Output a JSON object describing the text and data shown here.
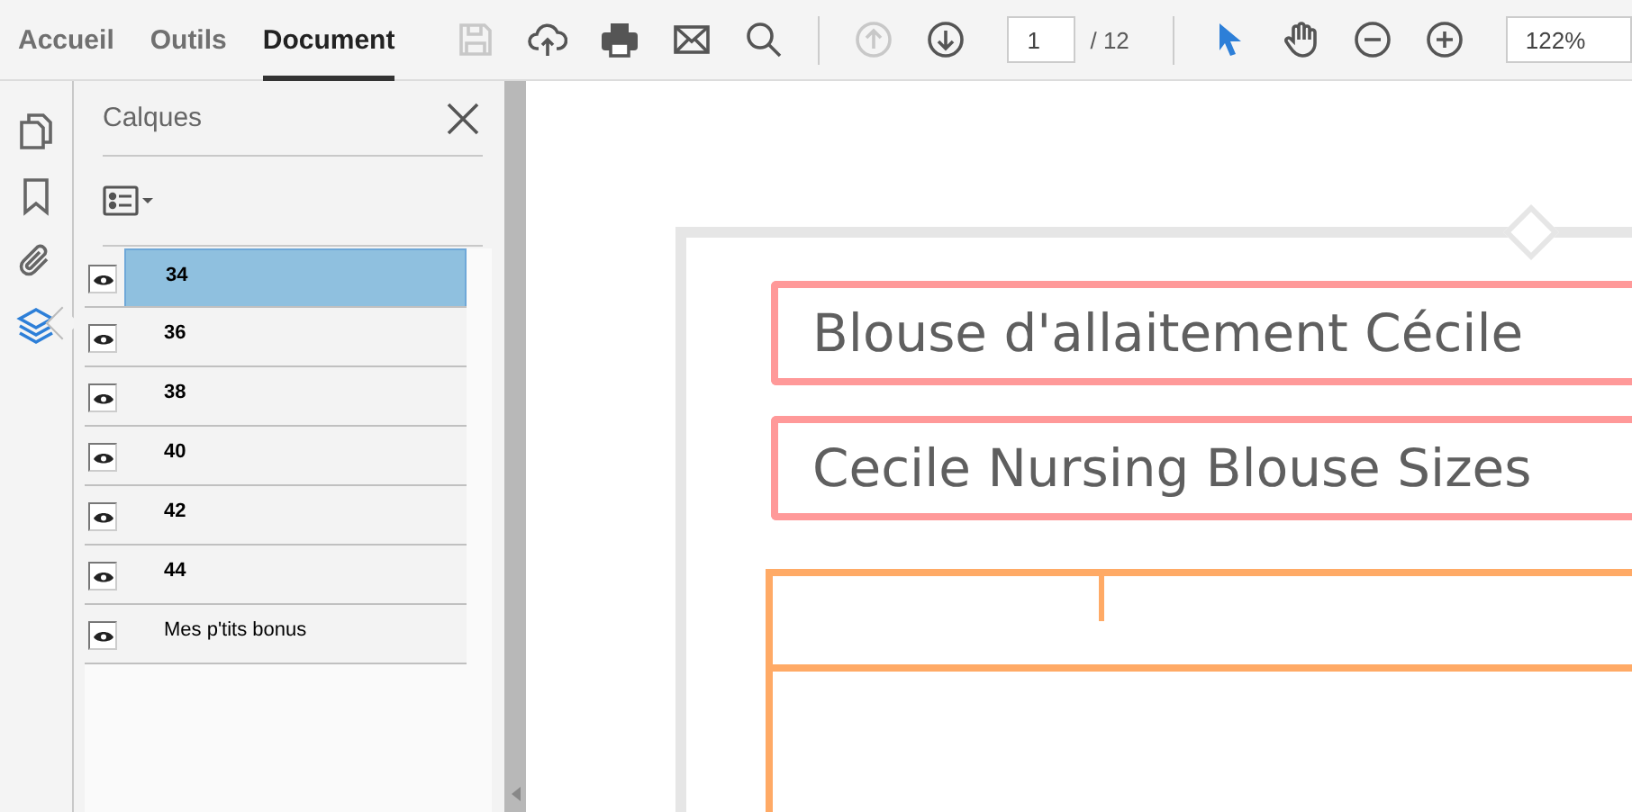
{
  "tabs": [
    {
      "label": "Accueil",
      "selected": false
    },
    {
      "label": "Outils",
      "selected": false
    },
    {
      "label": "Document",
      "selected": true
    }
  ],
  "toolbar": {
    "tools": [
      {
        "kind": "save",
        "disabled": true
      },
      {
        "kind": "upload",
        "disabled": false
      },
      {
        "kind": "print",
        "disabled": false
      },
      {
        "kind": "mail",
        "disabled": false
      },
      {
        "kind": "search",
        "disabled": false
      },
      {
        "kind": "separator"
      },
      {
        "kind": "prev",
        "disabled": true
      },
      {
        "kind": "next",
        "disabled": false
      },
      {
        "kind": "page"
      },
      {
        "kind": "separator"
      },
      {
        "kind": "pointer",
        "selected": true
      },
      {
        "kind": "hand",
        "selected": false
      },
      {
        "kind": "zoomout",
        "disabled": false
      },
      {
        "kind": "zoomin",
        "disabled": false
      },
      {
        "kind": "zoom"
      }
    ],
    "page_number": "1",
    "page_total": "/ 12",
    "zoom": "122%"
  },
  "rail": [
    {
      "kind": "pages",
      "selected": false
    },
    {
      "kind": "bookmark",
      "selected": false
    },
    {
      "kind": "attachment",
      "selected": false
    },
    {
      "kind": "layers",
      "selected": true
    }
  ],
  "layers_panel": {
    "title": "Calques",
    "layers": [
      {
        "label": "34",
        "visible": true,
        "selected": true
      },
      {
        "label": "36",
        "visible": true,
        "selected": false
      },
      {
        "label": "38",
        "visible": true,
        "selected": false
      },
      {
        "label": "40",
        "visible": true,
        "selected": false
      },
      {
        "label": "42",
        "visible": true,
        "selected": false
      },
      {
        "label": "44",
        "visible": true,
        "selected": false
      },
      {
        "label": "Mes p'tits bonus",
        "visible": true,
        "selected": false
      }
    ]
  },
  "document": {
    "headings": [
      "Blouse d'allaitement Cécile",
      "Cecile Nursing Blouse Sizes"
    ]
  }
}
